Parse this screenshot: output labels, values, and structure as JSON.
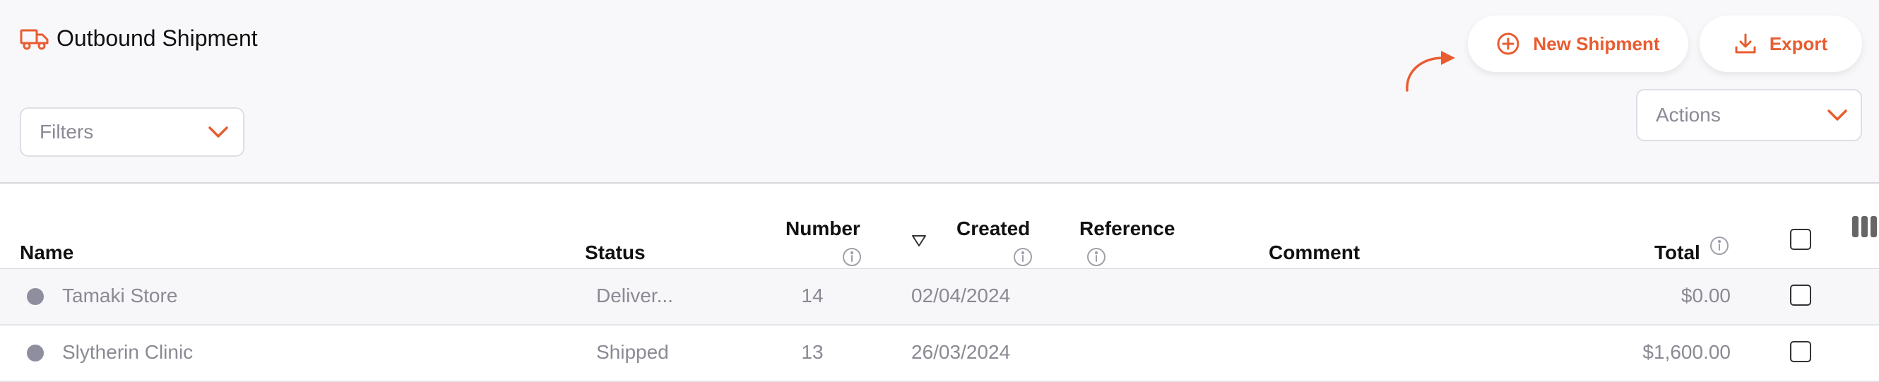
{
  "header": {
    "title": "Outbound Shipment",
    "title_icon": "truck-icon",
    "filters_label": "Filters",
    "new_shipment_label": "New Shipment",
    "export_label": "Export",
    "actions_label": "Actions"
  },
  "colors": {
    "accent": "#e95c30",
    "status_dot": "#8e8e9e",
    "muted_text": "#8a8a94"
  },
  "table": {
    "columns": {
      "name": "Name",
      "status": "Status",
      "number": "Number",
      "created": "Created",
      "reference": "Reference",
      "comment": "Comment",
      "total": "Total"
    },
    "rows": [
      {
        "name": "Tamaki Store",
        "status": "Deliver...",
        "number": "14",
        "created": "02/04/2024",
        "reference": "",
        "comment": "",
        "total": "$0.00",
        "checked": false
      },
      {
        "name": "Slytherin Clinic",
        "status": "Shipped",
        "number": "13",
        "created": "26/03/2024",
        "reference": "",
        "comment": "",
        "total": "$1,600.00",
        "checked": false
      }
    ]
  }
}
